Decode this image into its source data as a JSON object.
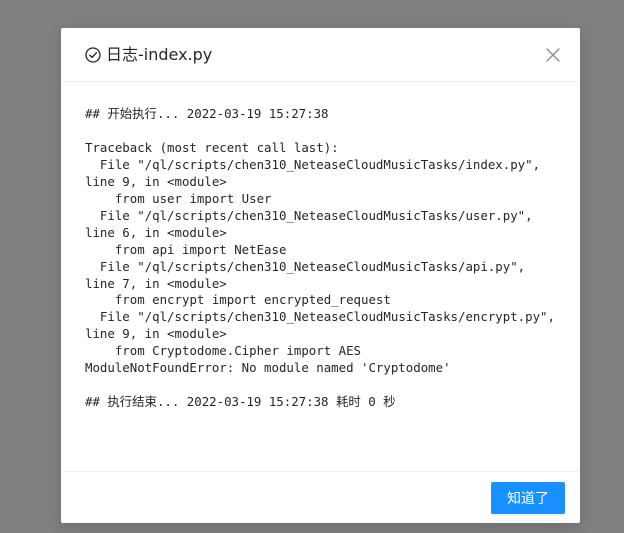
{
  "modal": {
    "title": "日志-index.py",
    "log": "## 开始执行... 2022-03-19 15:27:38\n\nTraceback (most recent call last):\n  File \"/ql/scripts/chen310_NeteaseCloudMusicTasks/index.py\", line 9, in <module>\n    from user import User\n  File \"/ql/scripts/chen310_NeteaseCloudMusicTasks/user.py\", line 6, in <module>\n    from api import NetEase\n  File \"/ql/scripts/chen310_NeteaseCloudMusicTasks/api.py\", line 7, in <module>\n    from encrypt import encrypted_request\n  File \"/ql/scripts/chen310_NeteaseCloudMusicTasks/encrypt.py\", line 9, in <module>\n    from Cryptodome.Cipher import AES\nModuleNotFoundError: No module named 'Cryptodome'\n\n## 执行结束... 2022-03-19 15:27:38 耗时 0 秒",
    "ok_label": "知道了",
    "icons": {
      "title": "check-circle-icon",
      "close": "close-icon"
    }
  },
  "colors": {
    "backdrop": "#7f7f7f",
    "primary": "#1890ff",
    "text": "#262626",
    "icon": "#8c8c8c"
  }
}
